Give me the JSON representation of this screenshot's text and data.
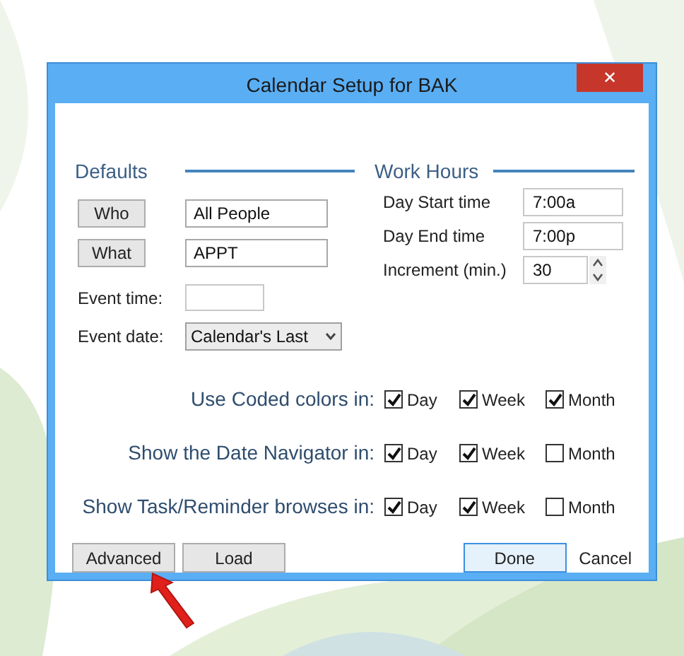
{
  "window": {
    "title": "Calendar Setup for BAK",
    "close": "✕"
  },
  "defaults": {
    "heading": "Defaults",
    "buttons": [
      {
        "label": "Who",
        "value": "All People"
      },
      {
        "label": "What",
        "value": "APPT"
      }
    ],
    "event_time": {
      "label": "Event time:"
    },
    "event_date": {
      "label": "Event date:",
      "value": "Calendar's Last"
    }
  },
  "work_hours": {
    "heading": "Work Hours",
    "fields": [
      {
        "label": "Day Start time",
        "value": "7:00a",
        "kind": "text"
      },
      {
        "label": "Day End time",
        "value": "7:00p",
        "kind": "text"
      },
      {
        "label": "Increment (min.)",
        "value": "30",
        "kind": "spinner"
      }
    ]
  },
  "options": [
    {
      "label": "Use Coded colors in:",
      "checks": [
        {
          "label": "Day",
          "checked": true
        },
        {
          "label": "Week",
          "checked": true
        },
        {
          "label": "Month",
          "checked": true
        }
      ]
    },
    {
      "label": "Show the Date Navigator in:",
      "checks": [
        {
          "label": "Day",
          "checked": true
        },
        {
          "label": "Week",
          "checked": true
        },
        {
          "label": "Month",
          "checked": false
        }
      ]
    },
    {
      "label": "Show Task/Reminder browses in:",
      "checks": [
        {
          "label": "Day",
          "checked": true
        },
        {
          "label": "Week",
          "checked": true
        },
        {
          "label": "Month",
          "checked": false
        }
      ]
    }
  ],
  "footer": {
    "buttons": [
      {
        "label": "Advanced",
        "kind": "button"
      },
      {
        "label": "Load",
        "kind": "button"
      },
      {
        "label": "Done",
        "kind": "default"
      },
      {
        "label": "Cancel",
        "kind": "link"
      }
    ]
  }
}
